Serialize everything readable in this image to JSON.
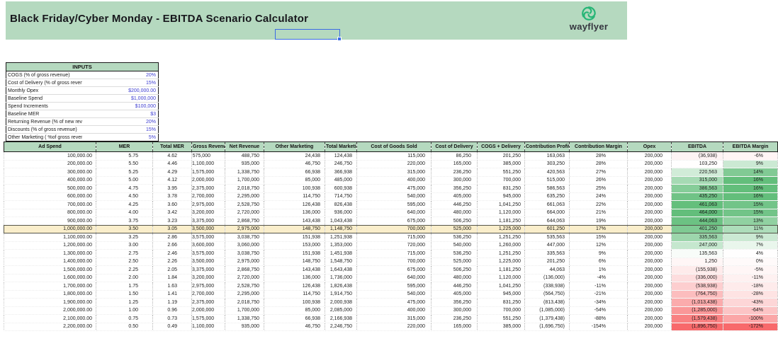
{
  "app": {
    "title": "Black Friday/Cyber Monday - EBITDA Scenario Calculator",
    "brand": "wayflyer"
  },
  "inputs": {
    "title": "INPUTS",
    "rows": [
      {
        "label": "COGS (% of gross revenue)",
        "value": "20%"
      },
      {
        "label": "Cost of Delivery (% of gross revenue",
        "value": "15%"
      },
      {
        "label": "Monthly Opex",
        "value": "$200,000.00"
      },
      {
        "label": "Baseline Spend",
        "value": "$1,000,000"
      },
      {
        "label": "Spend Increments",
        "value": "$100,000"
      },
      {
        "label": "Baseline MER",
        "value": "$3"
      },
      {
        "label": "Returning Revenue (% of new revenue)",
        "value": "20%"
      },
      {
        "label": "Discounts (% of gross revenue)",
        "value": "15%"
      },
      {
        "label": "Other Marketing ( %of gross revenue)",
        "value": "5%"
      }
    ]
  },
  "scenario_table": {
    "columns": [
      "Ad Spend",
      "MER",
      "Total MER",
      "Gross Revenue",
      "Net Revenue",
      "Other Marketing",
      "Total Marketing",
      "Cost of Goods Sold",
      "Cost of Delivery",
      "COGS + Delivery",
      "Contribution Profit",
      "Contribution Margin",
      "Opex",
      "EBITDA",
      "EBITDA Margin"
    ],
    "highlighted_row_index": 9,
    "rows": [
      [
        "100,000.00",
        "5.75",
        "4.62",
        "575,000",
        "488,750",
        "24,438",
        "124,438",
        "115,000",
        "86,250",
        "201,250",
        "163,063",
        "28%",
        "200,000",
        "(36,938)",
        "-6%"
      ],
      [
        "200,000.00",
        "5.50",
        "4.46",
        "1,100,000",
        "935,000",
        "46,750",
        "246,750",
        "220,000",
        "165,000",
        "385,000",
        "303,250",
        "28%",
        "200,000",
        "103,250",
        "9%"
      ],
      [
        "300,000.00",
        "5.25",
        "4.29",
        "1,575,000",
        "1,338,750",
        "66,938",
        "366,938",
        "315,000",
        "236,250",
        "551,250",
        "420,563",
        "27%",
        "200,000",
        "220,563",
        "14%"
      ],
      [
        "400,000.00",
        "5.00",
        "4.12",
        "2,000,000",
        "1,700,000",
        "85,000",
        "485,000",
        "400,000",
        "300,000",
        "700,000",
        "515,000",
        "26%",
        "200,000",
        "315,000",
        "16%"
      ],
      [
        "500,000.00",
        "4.75",
        "3.95",
        "2,375,000",
        "2,018,750",
        "100,938",
        "600,938",
        "475,000",
        "356,250",
        "831,250",
        "586,563",
        "25%",
        "200,000",
        "386,563",
        "16%"
      ],
      [
        "600,000.00",
        "4.50",
        "3.78",
        "2,700,000",
        "2,295,000",
        "114,750",
        "714,750",
        "540,000",
        "405,000",
        "945,000",
        "635,250",
        "24%",
        "200,000",
        "435,250",
        "16%"
      ],
      [
        "700,000.00",
        "4.25",
        "3.60",
        "2,975,000",
        "2,528,750",
        "126,438",
        "826,438",
        "595,000",
        "446,250",
        "1,041,250",
        "661,063",
        "22%",
        "200,000",
        "461,063",
        "15%"
      ],
      [
        "800,000.00",
        "4.00",
        "3.42",
        "3,200,000",
        "2,720,000",
        "136,000",
        "936,000",
        "640,000",
        "480,000",
        "1,120,000",
        "664,000",
        "21%",
        "200,000",
        "464,000",
        "15%"
      ],
      [
        "900,000.00",
        "3.75",
        "3.23",
        "3,375,000",
        "2,868,750",
        "143,438",
        "1,043,438",
        "675,000",
        "506,250",
        "1,181,250",
        "644,063",
        "19%",
        "200,000",
        "444,063",
        "13%"
      ],
      [
        "1,000,000.00",
        "3.50",
        "3.05",
        "3,500,000",
        "2,975,000",
        "148,750",
        "1,148,750",
        "700,000",
        "525,000",
        "1,225,000",
        "601,250",
        "17%",
        "200,000",
        "401,250",
        "11%"
      ],
      [
        "1,100,000.00",
        "3.25",
        "2.86",
        "3,575,000",
        "3,038,750",
        "151,938",
        "1,251,938",
        "715,000",
        "536,250",
        "1,251,250",
        "535,563",
        "15%",
        "200,000",
        "335,563",
        "9%"
      ],
      [
        "1,200,000.00",
        "3.00",
        "2.66",
        "3,600,000",
        "3,060,000",
        "153,000",
        "1,353,000",
        "720,000",
        "540,000",
        "1,260,000",
        "447,000",
        "12%",
        "200,000",
        "247,000",
        "7%"
      ],
      [
        "1,300,000.00",
        "2.75",
        "2.46",
        "3,575,000",
        "3,038,750",
        "151,938",
        "1,451,938",
        "715,000",
        "536,250",
        "1,251,250",
        "335,563",
        "9%",
        "200,000",
        "135,563",
        "4%"
      ],
      [
        "1,400,000.00",
        "2.50",
        "2.26",
        "3,500,000",
        "2,975,000",
        "148,750",
        "1,548,750",
        "700,000",
        "525,000",
        "1,225,000",
        "201,250",
        "6%",
        "200,000",
        "1,250",
        "0%"
      ],
      [
        "1,500,000.00",
        "2.25",
        "2.05",
        "3,375,000",
        "2,868,750",
        "143,438",
        "1,643,438",
        "675,000",
        "506,250",
        "1,181,250",
        "44,063",
        "1%",
        "200,000",
        "(155,938)",
        "-5%"
      ],
      [
        "1,600,000.00",
        "2.00",
        "1.84",
        "3,200,000",
        "2,720,000",
        "136,000",
        "1,736,000",
        "640,000",
        "480,000",
        "1,120,000",
        "(136,000)",
        "-4%",
        "200,000",
        "(336,000)",
        "-11%"
      ],
      [
        "1,700,000.00",
        "1.75",
        "1.63",
        "2,975,000",
        "2,528,750",
        "126,438",
        "1,826,438",
        "595,000",
        "446,250",
        "1,041,250",
        "(338,938)",
        "-11%",
        "200,000",
        "(538,938)",
        "-18%"
      ],
      [
        "1,800,000.00",
        "1.50",
        "1.41",
        "2,700,000",
        "2,295,000",
        "114,750",
        "1,914,750",
        "540,000",
        "405,000",
        "945,000",
        "(564,750)",
        "-21%",
        "200,000",
        "(764,750)",
        "-28%"
      ],
      [
        "1,900,000.00",
        "1.25",
        "1.19",
        "2,375,000",
        "2,018,750",
        "100,938",
        "2,000,938",
        "475,000",
        "356,250",
        "831,250",
        "(813,438)",
        "-34%",
        "200,000",
        "(1,013,438)",
        "-43%"
      ],
      [
        "2,000,000.00",
        "1.00",
        "0.96",
        "2,000,000",
        "1,700,000",
        "85,000",
        "2,085,000",
        "400,000",
        "300,000",
        "700,000",
        "(1,085,000)",
        "-54%",
        "200,000",
        "(1,285,000)",
        "-64%"
      ],
      [
        "2,100,000.00",
        "0.75",
        "0.73",
        "1,575,000",
        "1,338,750",
        "66,938",
        "2,166,938",
        "315,000",
        "236,250",
        "551,250",
        "(1,379,438)",
        "-88%",
        "200,000",
        "(1,579,438)",
        "-100%"
      ],
      [
        "2,200,000.00",
        "0.50",
        "0.49",
        "1,100,000",
        "935,000",
        "46,750",
        "2,246,750",
        "220,000",
        "165,000",
        "385,000",
        "(1,696,750)",
        "-154%",
        "200,000",
        "(1,896,750)",
        "-172%"
      ]
    ]
  },
  "colors": {
    "band_green": "#b5d9bf",
    "highlight_yellow": "#faeecb",
    "input_blue": "#3d3dd1",
    "selection_blue": "#3b6be4",
    "logo_green": "#26b576",
    "title_color": "#17171c",
    "scale_red": "#f8696b",
    "scale_mid": "#ffffff",
    "scale_green": "#63be7b"
  }
}
